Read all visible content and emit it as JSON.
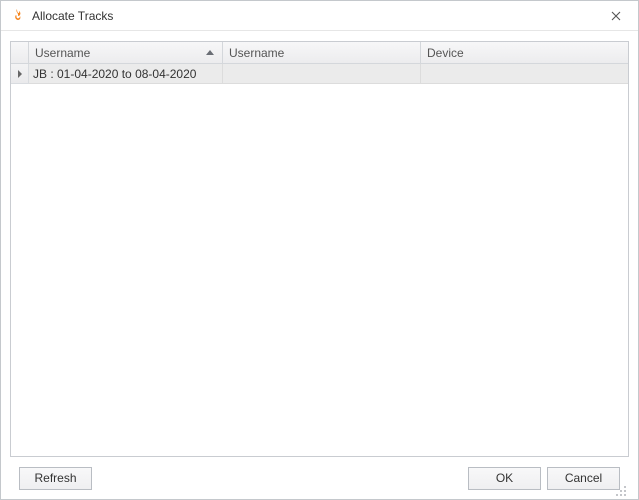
{
  "title": "Allocate Tracks",
  "columns": {
    "col1": "Username",
    "col2": "Username",
    "col3": "Device"
  },
  "rows": [
    {
      "col1": "JB : 01-04-2020 to 08-04-2020",
      "col2": "",
      "col3": ""
    }
  ],
  "buttons": {
    "refresh": "Refresh",
    "ok": "OK",
    "cancel": "Cancel"
  }
}
